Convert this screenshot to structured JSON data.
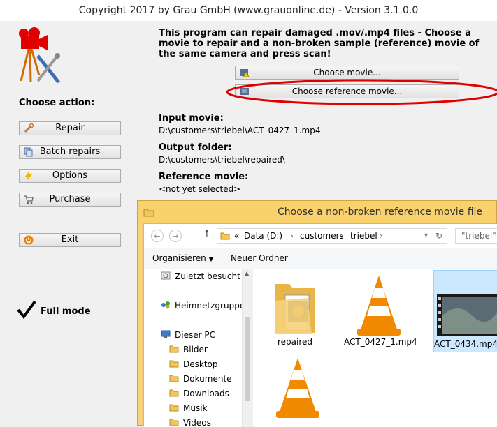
{
  "window": {
    "title": "Copyright 2017 by Grau GmbH (www.grauonline.de) - Version 3.1.0.0"
  },
  "sidebar": {
    "choose_action": "Choose action:",
    "buttons": [
      {
        "label": "Repair",
        "icon": "wrench-icon"
      },
      {
        "label": "Batch repairs",
        "icon": "batch-icon"
      },
      {
        "label": "Options",
        "icon": "lightning-icon"
      },
      {
        "label": "Purchase",
        "icon": "cart-icon"
      }
    ],
    "exit": {
      "label": "Exit",
      "icon": "power-icon"
    },
    "mode": {
      "label": "Full mode",
      "icon": "checkmark-icon"
    }
  },
  "main": {
    "intro": "This program can repair damaged .mov/.mp4 files - Choose a movie to repair and a non-broken sample (reference) movie of the same camera and press scan!",
    "choose_movie": "Choose movie...",
    "choose_reference": "Choose reference movie...",
    "input_heading": "Input movie:",
    "input_value": "D:\\customers\\triebel\\ACT_0427_1.mp4",
    "output_heading": "Output folder:",
    "output_value": "D:\\customers\\triebel\\repaired\\",
    "reference_heading": "Reference movie:",
    "reference_value": "<not yet selected>"
  },
  "dialog": {
    "title": "Choose a non-broken reference movie file",
    "nav": {
      "back": "←",
      "forward": "→",
      "up": "↑"
    },
    "address": {
      "prefix": "«",
      "parts": [
        "Data (D:)",
        "customers",
        "triebel"
      ]
    },
    "search_placeholder": "\"triebel\"",
    "toolbar": {
      "organize": "Organisieren",
      "new_folder": "Neuer Ordner"
    },
    "navpane": [
      "Zuletzt besucht",
      "Heimnetzgruppe",
      "Dieser PC",
      "Bilder",
      "Desktop",
      "Dokumente",
      "Downloads",
      "Musik",
      "Videos"
    ],
    "files": [
      {
        "name": "repaired",
        "type": "folder"
      },
      {
        "name": "ACT_0427_1.mp4",
        "type": "vlc"
      },
      {
        "name": "ACT_0434.mp4",
        "type": "video"
      },
      {
        "name": "",
        "type": "vlc"
      }
    ]
  },
  "colors": {
    "accent": "#e00000",
    "dialog_frame": "#f7d27a",
    "selection": "#cce8ff"
  }
}
